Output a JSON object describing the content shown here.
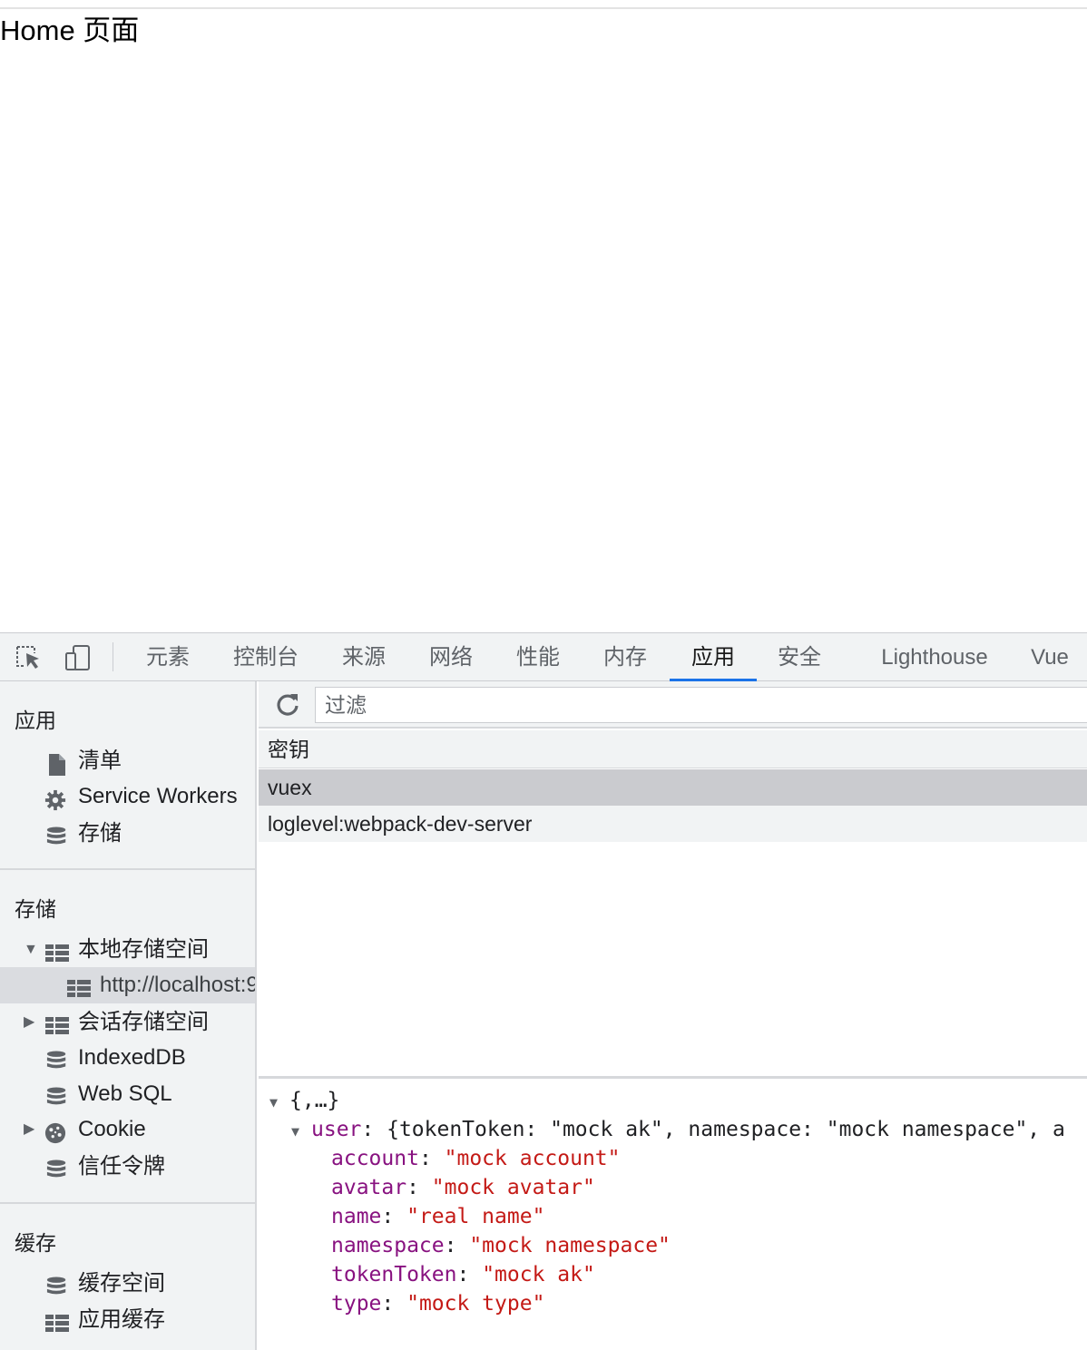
{
  "page": {
    "heading": "Home 页面"
  },
  "devtools": {
    "tabs": [
      "元素",
      "控制台",
      "来源",
      "网络",
      "性能",
      "内存",
      "应用",
      "安全",
      "Lighthouse",
      "Vue"
    ],
    "active_tab": "应用",
    "sidebar": {
      "sections": [
        {
          "title": "应用",
          "items": [
            {
              "label": "清单",
              "icon": "document-icon"
            },
            {
              "label": "Service Workers",
              "icon": "gear-icon"
            },
            {
              "label": "存储",
              "icon": "database-icon"
            }
          ]
        },
        {
          "title": "存储",
          "items": [
            {
              "label": "本地存储空间",
              "icon": "grid-icon",
              "expanded": true
            },
            {
              "label": "http://localhost:9",
              "icon": "grid-icon",
              "selected": true
            },
            {
              "label": "会话存储空间",
              "icon": "grid-icon",
              "expanded": false
            },
            {
              "label": "IndexedDB",
              "icon": "database-icon"
            },
            {
              "label": "Web SQL",
              "icon": "database-icon"
            },
            {
              "label": "Cookie",
              "icon": "cookie-icon",
              "expanded": false
            },
            {
              "label": "信任令牌",
              "icon": "database-icon"
            }
          ]
        },
        {
          "title": "缓存",
          "items": [
            {
              "label": "缓存空间",
              "icon": "database-icon"
            },
            {
              "label": "应用缓存",
              "icon": "grid-icon"
            }
          ]
        }
      ]
    },
    "storage": {
      "filter_placeholder": "过滤",
      "column_key": "密钥",
      "rows": [
        "vuex",
        "loglevel:webpack-dev-server"
      ],
      "selected_row": "vuex"
    },
    "preview": {
      "root": "{,…}",
      "user_summary_key": "user",
      "user_summary": "{tokenToken: \"mock ak\", namespace: \"mock namespace\", a",
      "fields": [
        {
          "key": "account",
          "value": "\"mock account\""
        },
        {
          "key": "avatar",
          "value": "\"mock avatar\""
        },
        {
          "key": "name",
          "value": "\"real name\""
        },
        {
          "key": "namespace",
          "value": "\"mock namespace\""
        },
        {
          "key": "tokenToken",
          "value": "\"mock ak\""
        },
        {
          "key": "type",
          "value": "\"mock type\""
        }
      ]
    }
  },
  "colors": {
    "accent": "#1a73e8",
    "json_key": "#881280",
    "json_string": "#c41a16"
  }
}
